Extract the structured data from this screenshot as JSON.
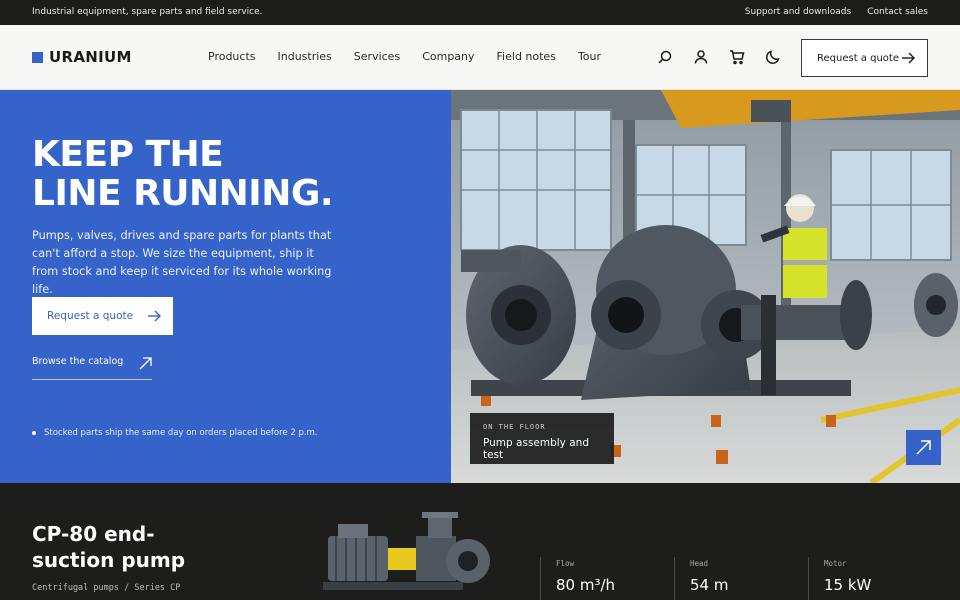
{
  "topbar": {
    "tagline": "Industrial equipment, spare parts and field service.",
    "links": [
      "Support and downloads",
      "Contact sales"
    ]
  },
  "brand": {
    "name": "URANIUM",
    "accent": "#3563c9"
  },
  "nav": {
    "items": [
      "Products",
      "Industries",
      "Services",
      "Company",
      "Field notes",
      "Tour"
    ],
    "icons": [
      "search-icon",
      "user-icon",
      "cart-icon",
      "moon-icon"
    ],
    "cta_label": "Request a quote"
  },
  "hero": {
    "title_line1": "KEEP THE",
    "title_line2": "LINE RUNNING.",
    "description": "Pumps, valves, drives and spare parts for plants that can't afford a stop. We size the equipment, ship it from stock and keep it serviced for its whole working life.",
    "primary_cta": "Request a quote",
    "secondary_cta": "Browse the catalog",
    "note": "Stocked parts ship the same day on orders placed before 2 p.m.",
    "background": "#3563c9"
  },
  "photo": {
    "caption_kicker": "ON THE FLOOR",
    "caption_title": "Pump assembly and test"
  },
  "product": {
    "title_line1": "CP-80 end-",
    "title_line2": "suction pump",
    "subtitle": "Centrifugal pumps / Series CP",
    "specs": [
      {
        "label": "Flow",
        "value": "80 m³/h"
      },
      {
        "label": "Head",
        "value": "54 m"
      },
      {
        "label": "Motor",
        "value": "15 kW"
      }
    ]
  }
}
